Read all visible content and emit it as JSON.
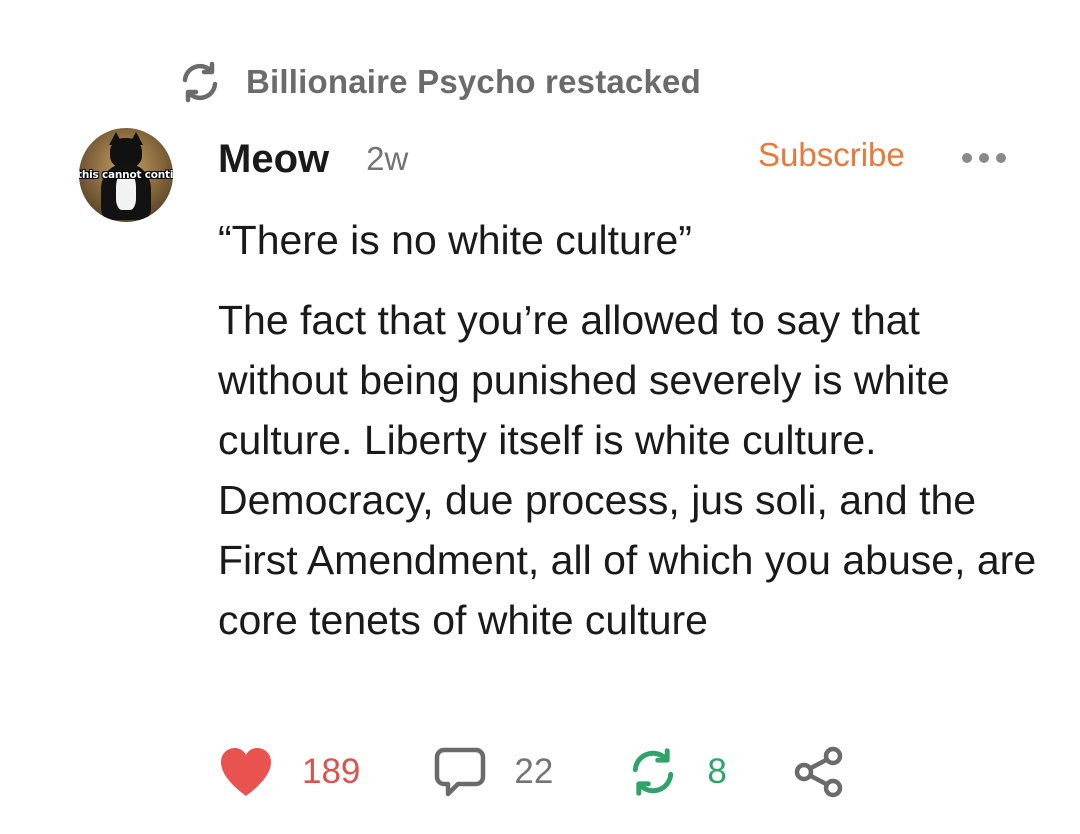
{
  "restack_bar": {
    "icon": "restack-icon",
    "text": "Billionaire Psycho restacked"
  },
  "author": {
    "avatar_caption": "this cannot continue",
    "name": "Meow",
    "timestamp": "2w"
  },
  "header_actions": {
    "subscribe_label": "Subscribe",
    "more_icon": "more-icon"
  },
  "post": {
    "quote": "“There is no white culture”",
    "paragraph": "The fact that you’re allowed to say that without being punished severely is white culture. Liberty itself is white culture. Democracy, due process, jus soli, and the First Amendment, all of which you abuse, are core tenets of white culture"
  },
  "actions": {
    "likes": "189",
    "comments": "22",
    "restacks": "8",
    "like_icon": "heart-icon",
    "comment_icon": "comment-icon",
    "restack_icon": "restack-icon",
    "share_icon": "share-icon"
  },
  "colors": {
    "accent": "#e8793a",
    "like": "#e8524f",
    "restack": "#2ea36c",
    "muted": "#757575"
  }
}
